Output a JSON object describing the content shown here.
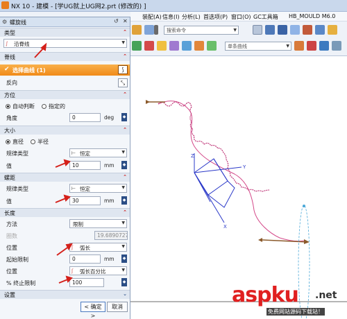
{
  "window": {
    "title": "NX 10 - 建模 - [学UG就上UG网2.prt  (修改的) ]"
  },
  "menubar": {
    "items": [
      "装配(A)",
      "信息(I)",
      "分析(L)",
      "首选项(P)",
      "窗口(O)",
      "GC工具箱",
      "HB_MOULD M6.0"
    ]
  },
  "toolbar": {
    "search_placeholder": "搜索命令",
    "curve_filter": "单条曲线"
  },
  "dialog": {
    "title": "螺旋线",
    "sections": {
      "type": {
        "label": "类型",
        "value": "沿脊线"
      },
      "spine": {
        "label": "脊线",
        "select_curve": "选择曲线 (1)",
        "reverse": "反向"
      },
      "orientation": {
        "label": "方位",
        "options": [
          "自动判断",
          "指定的"
        ],
        "selected": "自动判断",
        "angle_label": "角度",
        "angle_value": "0",
        "angle_unit": "deg"
      },
      "size": {
        "label": "大小",
        "options": [
          "直径",
          "半径"
        ],
        "selected": "直径",
        "law_type_label": "规律类型",
        "law_type_value": "恒定",
        "value_label": "值",
        "value": "10",
        "unit": "mm"
      },
      "pitch": {
        "label": "螺距",
        "law_type_label": "规律类型",
        "law_type_value": "恒定",
        "value_label": "值",
        "value": "30",
        "unit": "mm"
      },
      "length": {
        "label": "长度",
        "method_label": "方法",
        "method_value": "限制",
        "turns_label": "圈数",
        "turns_value": "19.68907275",
        "position_label": "位置",
        "position_value": "弧长",
        "start_label": "起始限制",
        "start_value": "0",
        "start_unit": "mm",
        "position2_label": "位置",
        "position2_value": "弧长百分比",
        "end_label": "% 终止限制",
        "end_value": "100"
      },
      "settings": {
        "label": "设置"
      }
    },
    "ok": "< 确定 >",
    "cancel": "取消"
  },
  "watermark": {
    "brand": "aspku",
    "tld": ".net",
    "subtitle": "免费网站源码下载站！"
  },
  "colors": {
    "accent_orange": "#f08a18",
    "arrow_red": "#d4201a",
    "helix_red": "#c0397a",
    "spine_magenta": "#d44a8a",
    "csys_blue": "#2a38c8"
  }
}
